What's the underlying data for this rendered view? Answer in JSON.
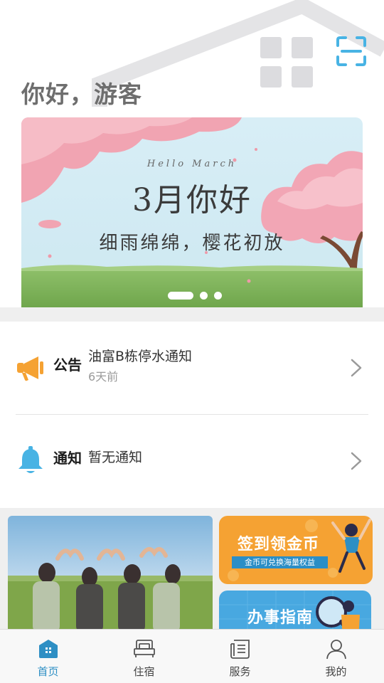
{
  "header": {
    "greeting": "你好，游客",
    "grid_icon": "grid-icon",
    "scan_icon": "scan-icon"
  },
  "banner": {
    "hello": "Hello March",
    "title": "3月你好",
    "subtitle": "细雨绵绵，樱花初放",
    "slide_count": 3,
    "active_slide": 1
  },
  "notices": [
    {
      "icon": "megaphone-icon",
      "label": "公告",
      "title": "油富B栋停水通知",
      "time": "6天前"
    },
    {
      "icon": "bell-icon",
      "label": "通知",
      "title": "暂无通知",
      "time": ""
    }
  ],
  "cards": {
    "sign_in": {
      "title": "签到领金币",
      "subtitle": "金币可兑换海量权益"
    },
    "guide": {
      "title": "办事指南"
    }
  },
  "tabbar": [
    {
      "label": "首页",
      "icon": "home-icon",
      "active": true
    },
    {
      "label": "住宿",
      "icon": "bed-icon",
      "active": false
    },
    {
      "label": "服务",
      "icon": "document-icon",
      "active": false
    },
    {
      "label": "我的",
      "icon": "user-icon",
      "active": false
    }
  ],
  "colors": {
    "accent": "#2e8fc4",
    "greeting": "#6e6e6e",
    "megaphone": "#f5a233",
    "bell": "#48b3e4",
    "sign_card": "#f5a233",
    "guide_card": "#48a8e0"
  }
}
